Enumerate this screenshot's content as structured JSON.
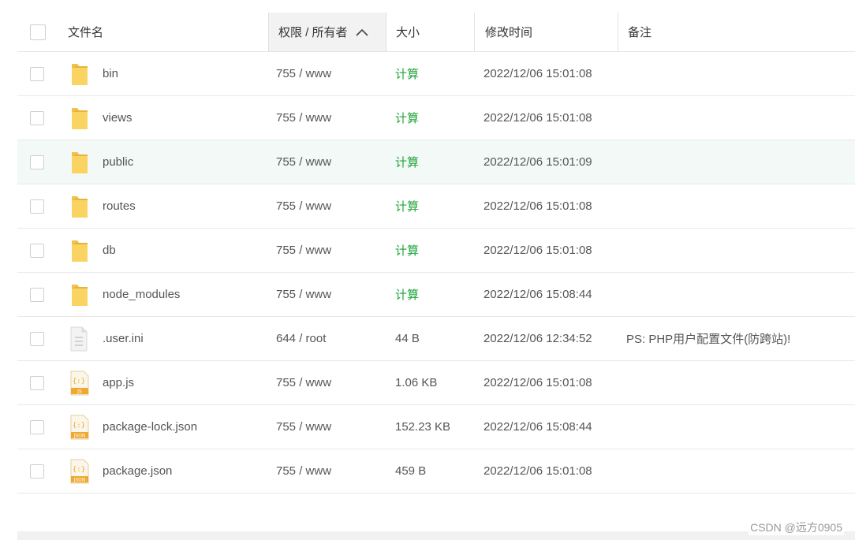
{
  "header": {
    "name": "文件名",
    "perm": "权限 / 所有者",
    "size": "大小",
    "time": "修改时间",
    "note": "备注"
  },
  "files": [
    {
      "name": "bin",
      "perm": "755 / www",
      "size": "计算",
      "time": "2022/12/06 15:01:08",
      "note": "",
      "icon": "folder-icon"
    },
    {
      "name": "views",
      "perm": "755 / www",
      "size": "计算",
      "time": "2022/12/06 15:01:08",
      "note": "",
      "icon": "folder-icon"
    },
    {
      "name": "public",
      "perm": "755 / www",
      "size": "计算",
      "time": "2022/12/06 15:01:09",
      "note": "",
      "icon": "folder-icon"
    },
    {
      "name": "routes",
      "perm": "755 / www",
      "size": "计算",
      "time": "2022/12/06 15:01:08",
      "note": "",
      "icon": "folder-icon"
    },
    {
      "name": "db",
      "perm": "755 / www",
      "size": "计算",
      "time": "2022/12/06 15:01:08",
      "note": "",
      "icon": "folder-icon"
    },
    {
      "name": "node_modules",
      "perm": "755 / www",
      "size": "计算",
      "time": "2022/12/06 15:08:44",
      "note": "",
      "icon": "folder-icon"
    },
    {
      "name": ".user.ini",
      "perm": "644 / root",
      "size": "44 B",
      "time": "2022/12/06 12:34:52",
      "note": "PS: PHP用户配置文件(防跨站)!",
      "icon": "text-file-icon"
    },
    {
      "name": "app.js",
      "perm": "755 / www",
      "size": "1.06 KB",
      "time": "2022/12/06 15:01:08",
      "note": "",
      "icon": "js-file-icon",
      "badge": "JS"
    },
    {
      "name": "package-lock.json",
      "perm": "755 / www",
      "size": "152.23 KB",
      "time": "2022/12/06 15:08:44",
      "note": "",
      "icon": "json-file-icon",
      "badge": "JSON"
    },
    {
      "name": "package.json",
      "perm": "755 / www",
      "size": "459 B",
      "time": "2022/12/06 15:01:08",
      "note": "",
      "icon": "json-file-icon",
      "badge": "JSON"
    }
  ],
  "file_icon_glyph": "{:}",
  "highlighted_row": "public",
  "watermark": "CSDN @远方0905",
  "colors": {
    "calc": "#20a53a",
    "folder": "#f7c948",
    "highlight": "#f2f9f7",
    "code_icon": "#f0a830"
  }
}
